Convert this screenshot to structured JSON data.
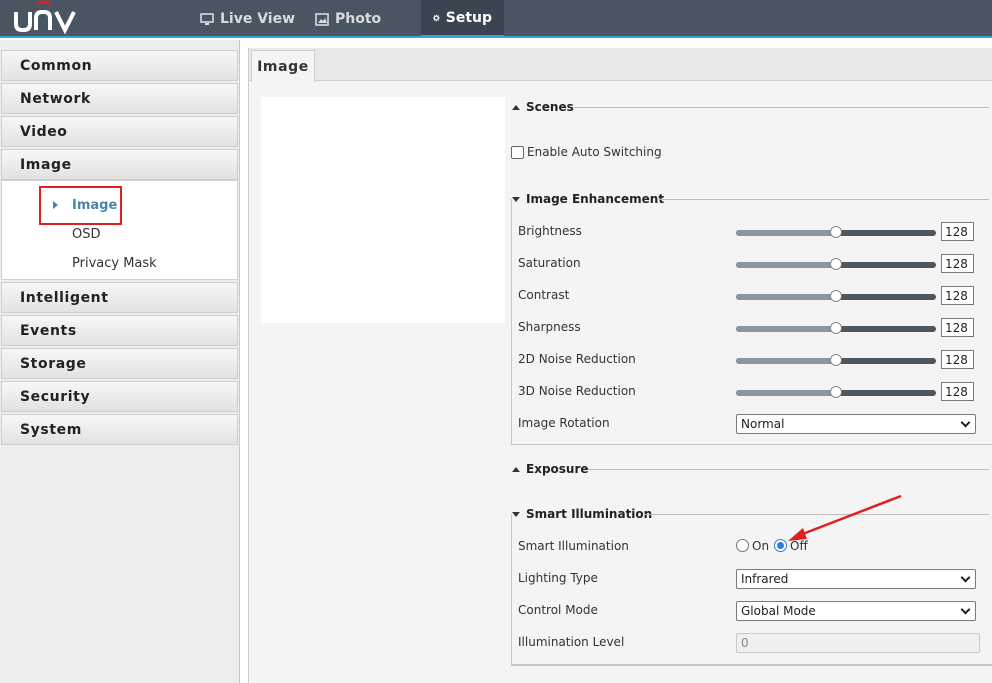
{
  "header": {
    "brand": "UNV",
    "tabs": [
      {
        "label": "Live View",
        "icon": "monitor-icon"
      },
      {
        "label": "Photo",
        "icon": "photo-icon"
      },
      {
        "label": "Setup",
        "icon": "gear-icon"
      }
    ]
  },
  "sidebar": {
    "items": [
      "Common",
      "Network",
      "Video",
      "Image",
      "Intelligent",
      "Events",
      "Storage",
      "Security",
      "System"
    ],
    "image_sub": [
      "Image",
      "OSD",
      "Privacy Mask"
    ]
  },
  "content": {
    "tab": "Image",
    "scenes": {
      "title": "Scenes",
      "auto_switch_label": "Enable Auto Switching"
    },
    "enhancement": {
      "title": "Image Enhancement",
      "sliders": [
        {
          "label": "Brightness",
          "value": "128",
          "level": 0.5
        },
        {
          "label": "Saturation",
          "value": "128",
          "level": 0.5
        },
        {
          "label": "Contrast",
          "value": "128",
          "level": 0.5
        },
        {
          "label": "Sharpness",
          "value": "128",
          "level": 0.5
        },
        {
          "label": "2D Noise Reduction",
          "value": "128",
          "level": 0.5
        },
        {
          "label": "3D Noise Reduction",
          "value": "128",
          "level": 0.5
        }
      ],
      "rotation_label": "Image Rotation",
      "rotation_value": "Normal"
    },
    "exposure": {
      "title": "Exposure"
    },
    "smart_illumination": {
      "title": "Smart Illumination",
      "toggle_label": "Smart Illumination",
      "on_label": "On",
      "off_label": "Off",
      "selected": "Off",
      "lighting_type_label": "Lighting Type",
      "lighting_type_value": "Infrared",
      "control_mode_label": "Control Mode",
      "control_mode_value": "Global Mode",
      "level_label": "Illumination Level",
      "level_value": "0"
    }
  },
  "colors": {
    "header_bg": "#4a5562",
    "accent": "#3aa0d8",
    "active_sub": "#4a86a8",
    "annotation": "#e02020"
  }
}
